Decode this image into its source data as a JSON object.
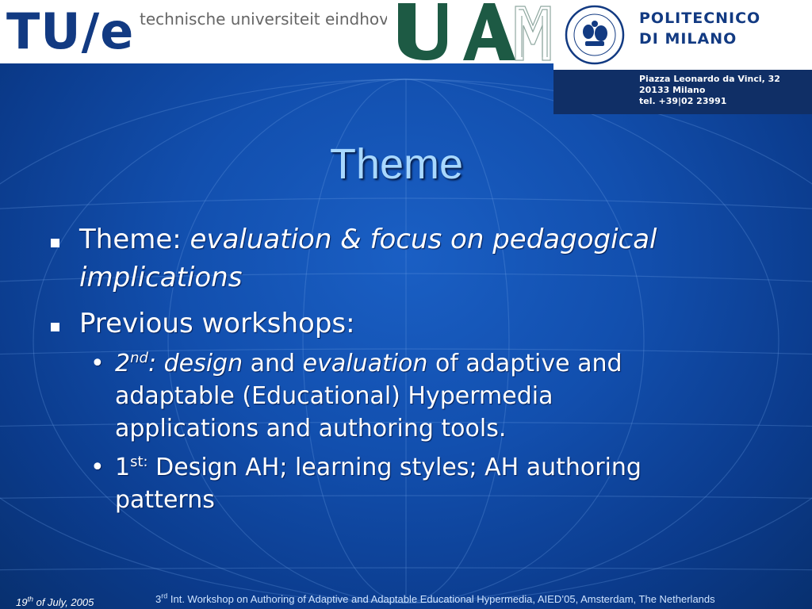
{
  "header": {
    "tue": {
      "mark": "TU/e",
      "name": "technische universiteit eindhoven"
    },
    "uam": {
      "mark": "UAM"
    },
    "polimi": {
      "name_line1": "POLITECNICO",
      "name_line2": "DI MILANO",
      "seal_text": "POLITECNICO MILANO",
      "address_line1": "Piazza Leonardo da Vinci, 32",
      "address_line2": "20133 Milano",
      "address_line3": "tel. +39|02 23991"
    }
  },
  "slide": {
    "title": "Theme",
    "bullets": [
      {
        "label": "Theme: ",
        "emphasis_line1": "evaluation & focus on pedagogical",
        "emphasis_line2": "implications"
      },
      {
        "label": "Previous workshops:"
      }
    ],
    "sub_bullets": [
      {
        "ordinal": "2",
        "ordinal_suffix": "nd",
        "topic": ": design",
        "joiner": " and ",
        "topic2": "evaluation",
        "rest_line1": " of adaptive and",
        "line2": "adaptable (Educational) Hypermedia",
        "line3": "applications and authoring tools."
      },
      {
        "ordinal": "1",
        "ordinal_suffix": "st:",
        "rest_line1": " Design AH; learning styles; AH authoring",
        "line2": "patterns"
      }
    ]
  },
  "footer": {
    "date_day": "19",
    "date_suffix": "th",
    "date_rest": "  of July, 2005",
    "event_num": "3",
    "event_suffix": "rd",
    "event_rest": " Int. Workshop on Authoring of Adaptive and Adaptable Educational Hypermedia, AIED’05, Amsterdam, The Netherlands"
  },
  "colors": {
    "background": "#124fae",
    "title": "#a8d8ff",
    "text": "#ffffff",
    "logo_navy": "#123a82",
    "address_bar": "#102f66",
    "uam_green": "#1d5a44"
  }
}
